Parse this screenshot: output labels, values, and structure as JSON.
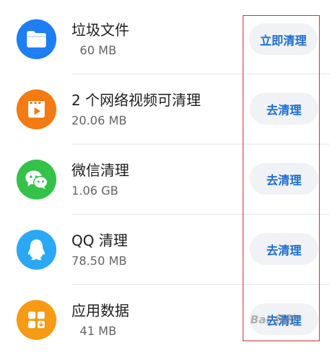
{
  "items": [
    {
      "title": "垃圾文件",
      "size": "60 MB",
      "button_label": "立即清理",
      "icon": "folder-icon",
      "icon_color": "#1e7ef2"
    },
    {
      "title": "2 个网络视频可清理",
      "size": "20.06 MB",
      "button_label": "去清理",
      "icon": "video-icon",
      "icon_color": "#f47a12"
    },
    {
      "title": "微信清理",
      "size": "1.06 GB",
      "button_label": "去清理",
      "icon": "wechat-icon",
      "icon_color": "#34c24a"
    },
    {
      "title": "QQ 清理",
      "size": "78.50 MB",
      "button_label": "去清理",
      "icon": "qq-icon",
      "icon_color": "#2ba8f5"
    },
    {
      "title": "应用数据",
      "size": "41 MB",
      "button_label": "去清理",
      "icon": "app-data-icon",
      "icon_color": "#f79a14"
    }
  ],
  "watermark": {
    "text": "Bai 经验"
  },
  "colors": {
    "button_text": "#1f6fd6",
    "button_bg": "#f0f2f5",
    "highlight_border": "#d3232f"
  }
}
